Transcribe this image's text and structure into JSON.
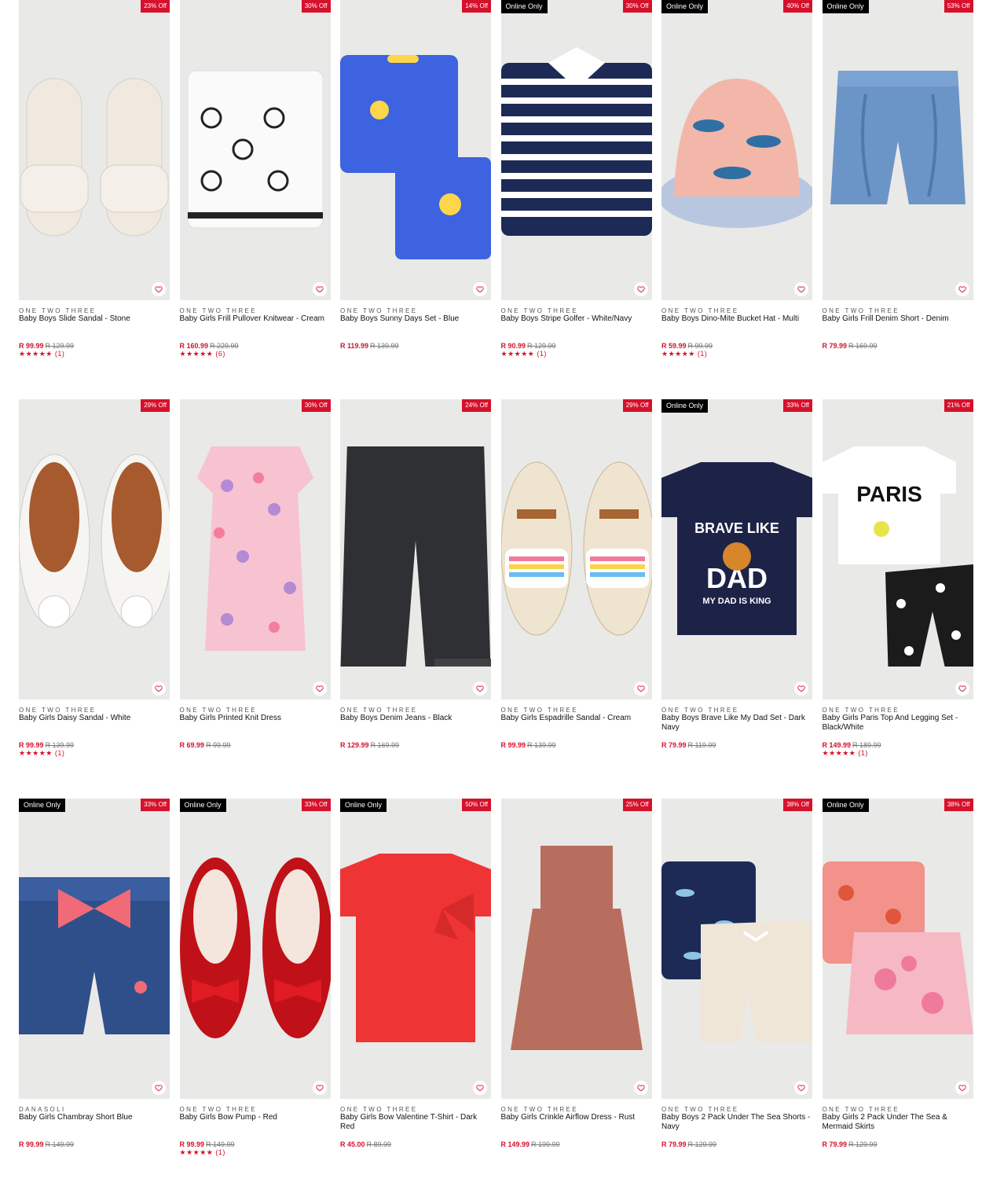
{
  "colors": {
    "accent": "#d6112c",
    "online_badge": "#000000",
    "image_bg": "#e9e9e7"
  },
  "products": [
    {
      "discount": "23% Off",
      "online": "",
      "brand": "ONE TWO THREE",
      "name": "Baby Boys Slide Sandal - Stone",
      "price": "R 99.99",
      "was": "R 129.99",
      "stars": "★★★★★",
      "reviews": "(1)",
      "art": "sandal-slide"
    },
    {
      "discount": "30% Off",
      "online": "",
      "brand": "ONE TWO THREE",
      "name": "Baby Girls Frill Pullover Knitwear - Cream",
      "price": "R 160.99",
      "was": "R 229.99",
      "stars": "★★★★★",
      "reviews": "(6)",
      "art": "knit"
    },
    {
      "discount": "14% Off",
      "online": "",
      "brand": "ONE TWO THREE",
      "name": "Baby Boys Sunny Days Set - Blue",
      "price": "R 119.99",
      "was": "R 139.99",
      "stars": "",
      "reviews": "",
      "art": "blue-set"
    },
    {
      "discount": "30% Off",
      "online": "Online Only",
      "brand": "ONE TWO THREE",
      "name": "Baby Boys Stripe Golfer - White/Navy",
      "price": "R 90.99",
      "was": "R 129.99",
      "stars": "★★★★★",
      "reviews": "(1)",
      "art": "stripe"
    },
    {
      "discount": "40% Off",
      "online": "Online Only",
      "brand": "ONE TWO THREE",
      "name": "Baby Boys Dino-Mite Bucket Hat - Multi",
      "price": "R 59.99",
      "was": "R 99.99",
      "stars": "★★★★★",
      "reviews": "(1)",
      "art": "hat"
    },
    {
      "discount": "53% Off",
      "online": "Online Only",
      "brand": "ONE TWO THREE",
      "name": "Baby Girls Frill Denim Short - Denim",
      "price": "R 79.99",
      "was": "R 169.99",
      "stars": "",
      "reviews": "",
      "art": "denim-short"
    },
    {
      "discount": "29% Off",
      "online": "",
      "brand": "ONE TWO THREE",
      "name": "Baby Girls Daisy Sandal - White",
      "price": "R 99.99",
      "was": "R 139.99",
      "stars": "★★★★★",
      "reviews": "(1)",
      "art": "daisy-sandal"
    },
    {
      "discount": "30% Off",
      "online": "",
      "brand": "ONE TWO THREE",
      "name": "Baby Girls Printed Knit Dress",
      "price": "R 69.99",
      "was": "R 99.99",
      "stars": "",
      "reviews": "",
      "art": "pink-dress"
    },
    {
      "discount": "24% Off",
      "online": "",
      "brand": "ONE TWO THREE",
      "name": "Baby Boys Denim Jeans - Black",
      "price": "R 129.99",
      "was": "R 169.99",
      "stars": "",
      "reviews": "",
      "art": "jeans"
    },
    {
      "discount": "29% Off",
      "online": "",
      "brand": "ONE TWO THREE",
      "name": "Baby Girls Espadrille Sandal - Cream",
      "price": "R 99.99",
      "was": "R 139.99",
      "stars": "",
      "reviews": "",
      "art": "espadrille"
    },
    {
      "discount": "33% Off",
      "online": "Online Only",
      "brand": "ONE TWO THREE",
      "name": "Baby Boys Brave Like My Dad Set - Dark Navy",
      "price": "R 79.99",
      "was": "R 119.99",
      "stars": "",
      "reviews": "",
      "art": "navy-tee"
    },
    {
      "discount": "21% Off",
      "online": "",
      "brand": "ONE TWO THREE",
      "name": "Baby Girls Paris Top And Legging Set - Black/White",
      "price": "R 149.99",
      "was": "R 189.99",
      "stars": "★★★★★",
      "reviews": "(1)",
      "art": "paris"
    },
    {
      "discount": "33% Off",
      "online": "Online Only",
      "brand": "DANASOLI",
      "name": "Baby Girls Chambray Short Blue",
      "price": "R 99.99",
      "was": "R 149.99",
      "stars": "",
      "reviews": "",
      "art": "chambray"
    },
    {
      "discount": "33% Off",
      "online": "Online Only",
      "brand": "ONE TWO THREE",
      "name": "Baby Girls Bow Pump - Red",
      "price": "R 99.99",
      "was": "R 149.99",
      "stars": "★★★★★",
      "reviews": "(1)",
      "art": "red-pump"
    },
    {
      "discount": "50% Off",
      "online": "Online Only",
      "brand": "ONE TWO THREE",
      "name": "Baby Girls Bow Valentine T-Shirt - Dark Red",
      "price": "R 45.00",
      "was": "R 89.99",
      "stars": "",
      "reviews": "",
      "art": "red-tee"
    },
    {
      "discount": "25% Off",
      "online": "",
      "brand": "ONE TWO THREE",
      "name": "Baby Girls Crinkle Airflow Dress - Rust",
      "price": "R 149.99",
      "was": "R 199.99",
      "stars": "",
      "reviews": "",
      "art": "rust-dress"
    },
    {
      "discount": "38% Off",
      "online": "",
      "brand": "ONE TWO THREE",
      "name": "Baby Boys 2 Pack Under The Sea Shorts - Navy",
      "price": "R 79.99",
      "was": "R 129.99",
      "stars": "",
      "reviews": "",
      "art": "sea-shorts"
    },
    {
      "discount": "38% Off",
      "online": "Online Only",
      "brand": "ONE TWO THREE",
      "name": "Baby Girls 2 Pack Under The Sea & Mermaid Skirts",
      "price": "R 79.99",
      "was": "R 129.99",
      "stars": "",
      "reviews": "",
      "art": "skirts"
    }
  ]
}
